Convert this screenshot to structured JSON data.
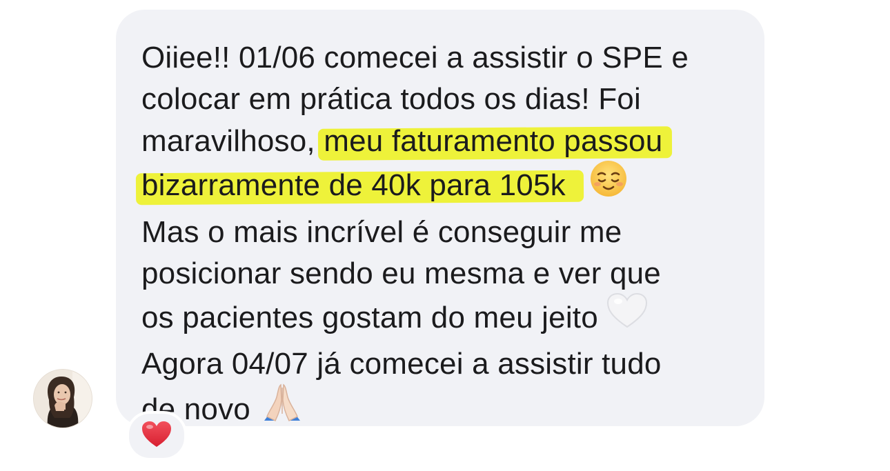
{
  "message": {
    "lines": [
      "Oiiee!! 01/06 comecei a assistir o SPE e",
      "colocar em prática todos os dias! Foi",
      "maravilhoso, ",
      "meu faturamento passou",
      "bizarramente de 40k para 105k",
      "Mas o mais incrível é conseguir me",
      "posicionar sendo eu mesma e ver que",
      "os pacientes gostam do meu jeito",
      "Agora 04/07 já comecei a assistir tudo",
      "de novo"
    ],
    "emojis": {
      "line5": "smiling-face-icon",
      "line8": "white-heart-icon",
      "line10": "folded-hands-icon"
    },
    "highlight_color": "#eef23a"
  },
  "reaction": {
    "icon": "red-heart-icon",
    "color": "#e1303f"
  },
  "avatar": {
    "icon": "user-avatar"
  },
  "colors": {
    "bubble": "#f1f2f6",
    "text": "#1b1b1d",
    "background": "#ffffff"
  }
}
